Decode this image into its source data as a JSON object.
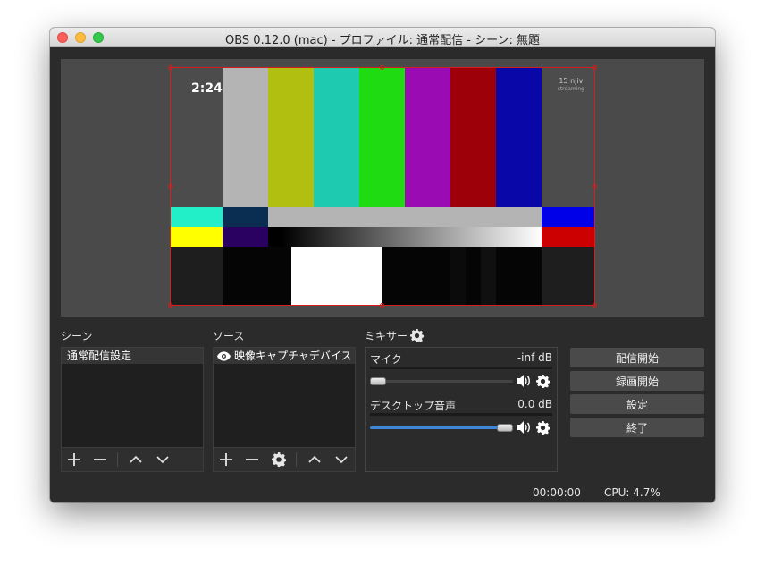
{
  "window": {
    "title": "OBS 0.12.0 (mac) - プロファイル: 通常配信 - シーン: 無題"
  },
  "preview": {
    "timecode": "2:24",
    "watermark_line1": "15 njiv",
    "watermark_line2": "streaming"
  },
  "scenes": {
    "label": "シーン",
    "items": [
      {
        "label": "通常配信設定",
        "selected": true
      }
    ]
  },
  "sources": {
    "label": "ソース",
    "items": [
      {
        "label": "映像キャプチャデバイス",
        "visible": true
      }
    ]
  },
  "mixer": {
    "label": "ミキサー",
    "channels": [
      {
        "name": "マイク",
        "db": "-inf dB",
        "volume": 0.0
      },
      {
        "name": "デスクトップ音声",
        "db": "0.0 dB",
        "volume": 1.0
      }
    ]
  },
  "controls": {
    "start_streaming": "配信開始",
    "start_recording": "録画開始",
    "settings": "設定",
    "exit": "終了"
  },
  "status": {
    "time": "00:00:00",
    "cpu": "CPU: 4.7%"
  },
  "icons": {
    "add": "plus-icon",
    "remove": "minus-icon",
    "up": "chevron-up-icon",
    "down": "chevron-down-icon",
    "properties": "gear-icon",
    "visibility": "eye-icon",
    "speaker": "speaker-icon"
  },
  "colors": {
    "selection_border": "#d71d1d",
    "volume_fill": "#3f86d8",
    "button_bg": "#4a4a4a"
  }
}
